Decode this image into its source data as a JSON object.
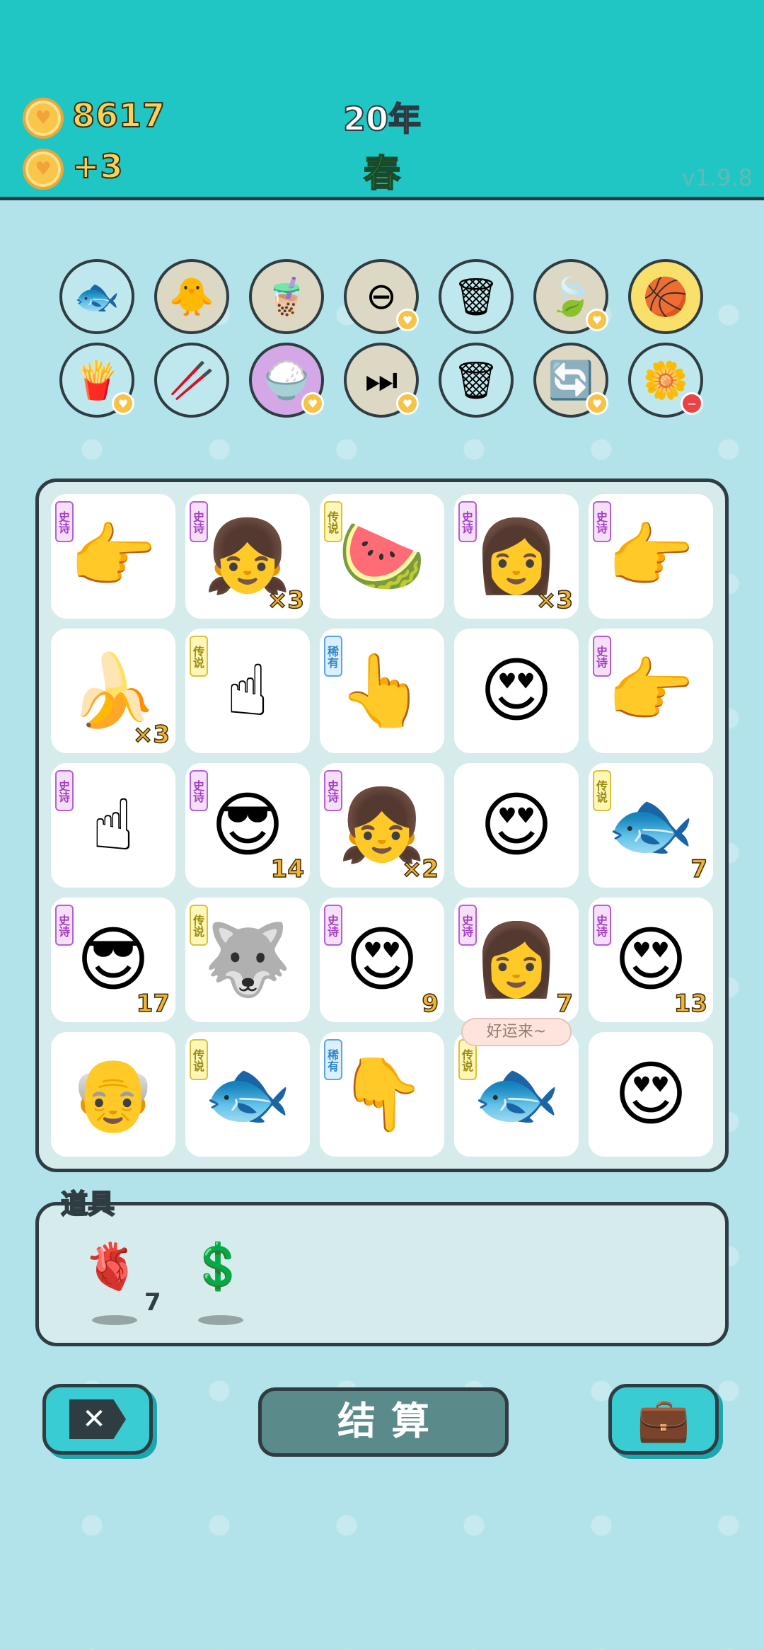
{
  "header": {
    "coins": "8617",
    "income": "+3",
    "year": "20年",
    "season": "春",
    "version": "v1.9.8"
  },
  "tools_row1": [
    {
      "name": "fishbowl-icon",
      "glyph": "🐟",
      "bg": "#bfe8ee",
      "badge": ""
    },
    {
      "name": "chick-egg-icon",
      "glyph": "🐥",
      "bg": "#ddd8c4",
      "badge": ""
    },
    {
      "name": "bubble-tea-icon",
      "glyph": "🧋",
      "bg": "#ddd8c4",
      "badge": ""
    },
    {
      "name": "remove-icon",
      "glyph": "⊖",
      "bg": "#ddd8c4",
      "badge": "♥"
    },
    {
      "name": "recycle-bag-icon",
      "glyph": "🗑",
      "bg": "#bfe8ee",
      "badge": ""
    },
    {
      "name": "leaf-icon",
      "glyph": "🍃",
      "bg": "#ddd8c4",
      "badge": "♥"
    },
    {
      "name": "basketballs-icon",
      "glyph": "🏀",
      "bg": "#f9e06a",
      "badge": ""
    }
  ],
  "tools_row2": [
    {
      "name": "fries-icon",
      "glyph": "🍟",
      "bg": "#bfe8ee",
      "badge": "♥"
    },
    {
      "name": "chopsticks-icon",
      "glyph": "🥢",
      "bg": "#bfe8ee",
      "badge": ""
    },
    {
      "name": "rice-bowl-icon",
      "glyph": "🍚",
      "bg": "#d4a8e6",
      "badge": "♥"
    },
    {
      "name": "skip-icon",
      "glyph": "⏭",
      "bg": "#ddd8c4",
      "badge": "♥"
    },
    {
      "name": "recycle-bag-icon",
      "glyph": "🗑",
      "bg": "#bfe8ee",
      "badge": ""
    },
    {
      "name": "refresh-icon",
      "glyph": "🔄",
      "bg": "#ddd8c4",
      "badge": "♥"
    },
    {
      "name": "flower-pot-icon",
      "glyph": "🌼",
      "bg": "#bfe8ee",
      "badge": "−"
    }
  ],
  "board": [
    {
      "name": "pointing-hand-icon",
      "glyph": "👉",
      "tag": "史诗",
      "tagc": "epic",
      "count": ""
    },
    {
      "name": "girl-heart-icon",
      "glyph": "👧",
      "tag": "史诗",
      "tagc": "epic",
      "count": "×3"
    },
    {
      "name": "watermelon-icon",
      "glyph": "🍉",
      "tag": "传说",
      "tagc": "legend",
      "count": ""
    },
    {
      "name": "girl-heart-icon",
      "glyph": "👩",
      "tag": "史诗",
      "tagc": "epic",
      "count": "×3"
    },
    {
      "name": "pointing-right-hand-icon",
      "glyph": "👉",
      "tag": "史诗",
      "tagc": "epic",
      "count": ""
    },
    {
      "name": "banana-icon",
      "glyph": "🍌",
      "tag": "",
      "tagc": "",
      "count": "×3"
    },
    {
      "name": "yellow-finger-icon",
      "glyph": "☝",
      "tag": "传说",
      "tagc": "legend",
      "count": ""
    },
    {
      "name": "brown-finger-icon",
      "glyph": "👆",
      "tag": "稀有",
      "tagc": "rare",
      "count": ""
    },
    {
      "name": "man-heart-eyes-icon",
      "glyph": "😍",
      "tag": "",
      "tagc": "",
      "count": ""
    },
    {
      "name": "pointing-hand-icon",
      "glyph": "👉",
      "tag": "史诗",
      "tagc": "epic",
      "count": ""
    },
    {
      "name": "raised-finger-icon",
      "glyph": "☝",
      "tag": "史诗",
      "tagc": "epic",
      "count": ""
    },
    {
      "name": "green-cap-man-icon",
      "glyph": "😎",
      "tag": "史诗",
      "tagc": "epic",
      "count": "14"
    },
    {
      "name": "girl-heart-icon",
      "glyph": "👧",
      "tag": "史诗",
      "tagc": "epic",
      "count": "×2"
    },
    {
      "name": "man-heart-eyes-icon",
      "glyph": "😍",
      "tag": "",
      "tagc": "",
      "count": ""
    },
    {
      "name": "koi-fish-icon",
      "glyph": "🐟",
      "tag": "传说",
      "tagc": "legend",
      "count": "7"
    },
    {
      "name": "green-cap-man-icon",
      "glyph": "😎",
      "tag": "史诗",
      "tagc": "epic",
      "count": "17"
    },
    {
      "name": "husky-king-icon",
      "glyph": "🐺",
      "tag": "传说",
      "tagc": "legend",
      "count": ""
    },
    {
      "name": "bald-man-heart-eyes-icon",
      "glyph": "😍",
      "tag": "史诗",
      "tagc": "epic",
      "count": "9"
    },
    {
      "name": "girl-icon",
      "glyph": "👩",
      "tag": "史诗",
      "tagc": "epic",
      "count": "7"
    },
    {
      "name": "green-cap-man-heart-icon",
      "glyph": "😍",
      "tag": "史诗",
      "tagc": "epic",
      "count": "13"
    },
    {
      "name": "old-man-glasses-icon",
      "glyph": "👴",
      "tag": "",
      "tagc": "",
      "count": ""
    },
    {
      "name": "koi-fish-icon",
      "glyph": "🐟",
      "tag": "传说",
      "tagc": "legend",
      "count": ""
    },
    {
      "name": "brown-finger-icon",
      "glyph": "👇",
      "tag": "稀有",
      "tagc": "rare",
      "count": ""
    },
    {
      "name": "koi-fish-icon",
      "glyph": "🐟",
      "tag": "传说",
      "tagc": "legend",
      "count": ""
    },
    {
      "name": "old-man-heart-eyes-icon",
      "glyph": "😍",
      "tag": "",
      "tagc": "",
      "count": ""
    }
  ],
  "bubble": "好运来~",
  "items": {
    "title": "道具",
    "list": [
      {
        "name": "liver-icon",
        "glyph": "🫀",
        "count": "7"
      },
      {
        "name": "dollar-coin-icon",
        "glyph": "💲",
        "count": ""
      }
    ]
  },
  "buttons": {
    "close_glyph": "✕",
    "settle": "结算",
    "bag_glyph": "💼"
  }
}
